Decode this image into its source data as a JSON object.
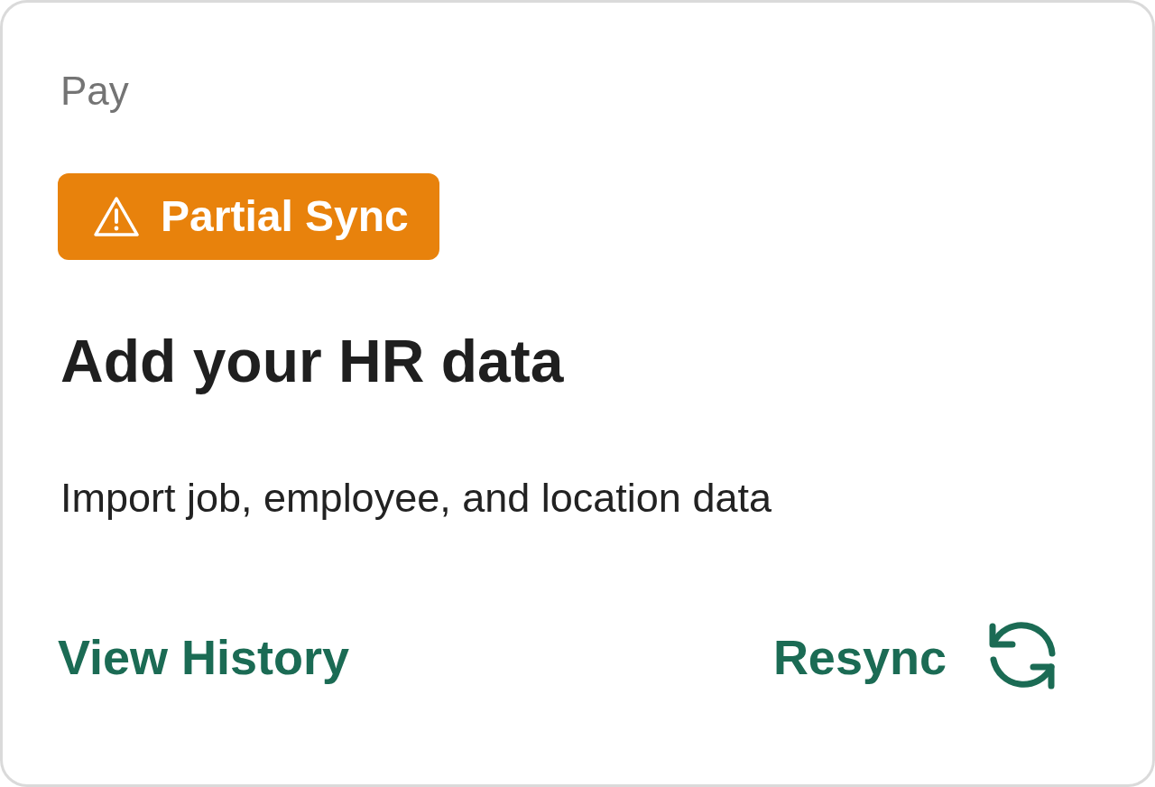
{
  "card": {
    "category": "Pay",
    "badge": {
      "label": "Partial Sync",
      "kind": "warning"
    },
    "title": "Add your HR data",
    "description": "Import job, employee, and location data",
    "footer": {
      "history_link": "View History",
      "resync_button": "Resync"
    }
  }
}
